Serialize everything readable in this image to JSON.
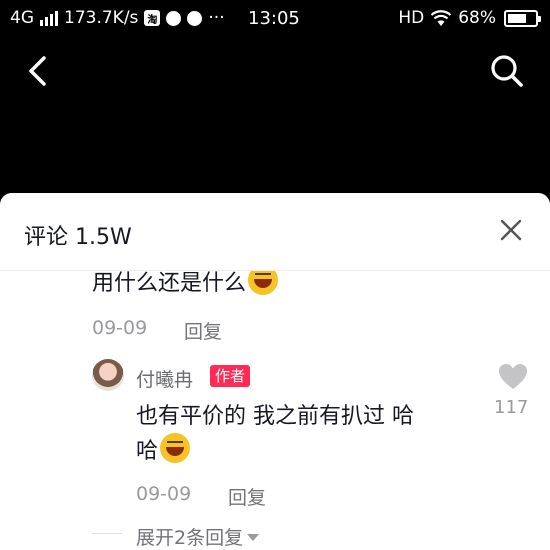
{
  "status_bar": {
    "network": "4G",
    "speed": "173.7K/s",
    "app_icon_label": "淘",
    "more": "···",
    "time": "13:05",
    "hd": "HD",
    "battery_text": "68%",
    "battery_level": 0.68
  },
  "nav": {
    "back_icon": "chevron-left-icon",
    "search_icon": "search-icon"
  },
  "comments": {
    "title": "评论 1.5W",
    "close_icon": "close-icon",
    "prev_comment": {
      "text": "用什么还是什么",
      "date": "09-09",
      "reply_label": "回复"
    },
    "reply": {
      "username": "付曦冉",
      "badge": "作者",
      "line1": "也有平价的 我之前有扒过 哈",
      "line2": "哈",
      "date": "09-09",
      "reply_label": "回复",
      "like_count": "117"
    },
    "expand_label": "展开2条回复"
  }
}
